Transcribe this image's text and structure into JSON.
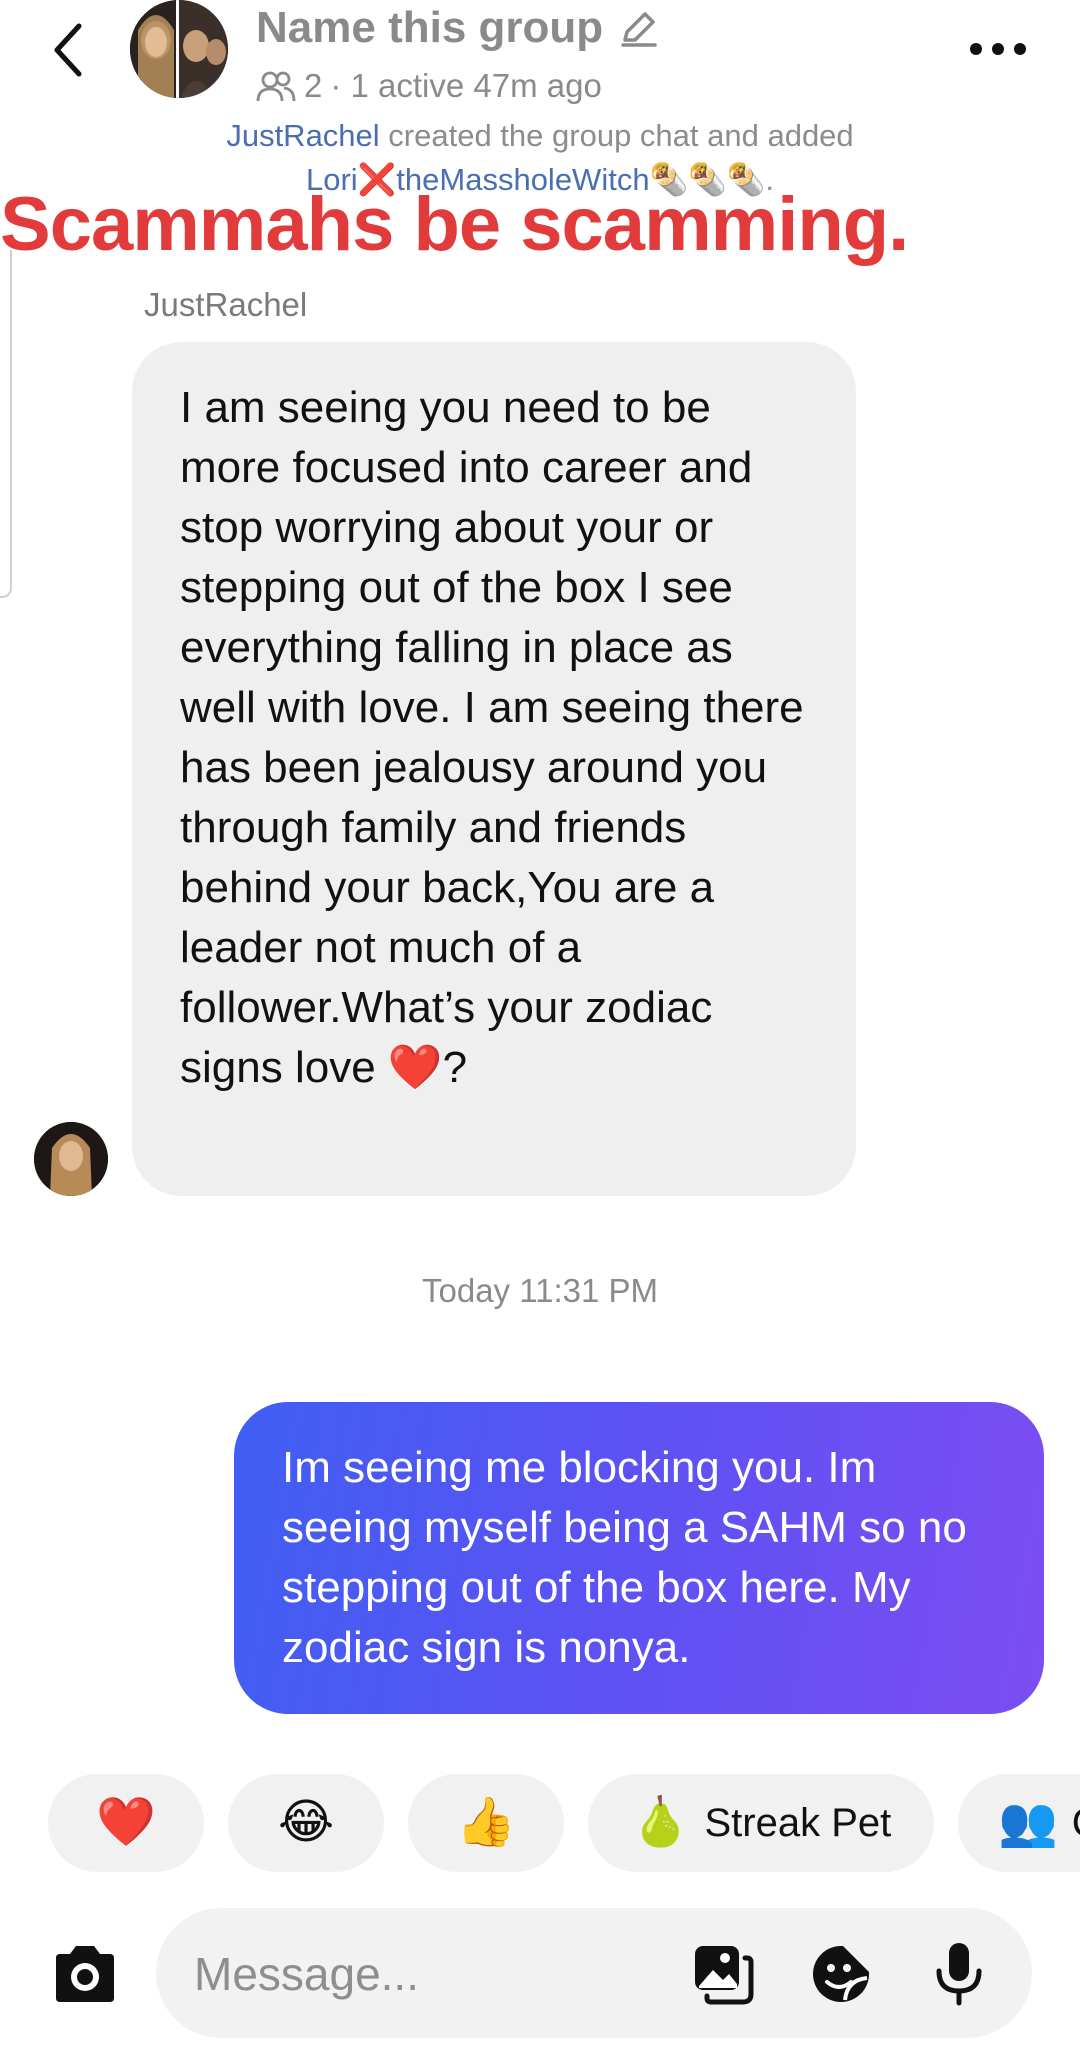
{
  "header": {
    "title": "Name this group",
    "members": "2",
    "status": "· 1 active 47m ago"
  },
  "system_notice": {
    "actor": "JustRachel",
    "middle": " created the group chat and added ",
    "target": "Lori❌theMassholeWitch🌯🌯🌯",
    "end": "."
  },
  "overlay_caption": "Scammahs be scamming.",
  "incoming": {
    "sender": "JustRachel",
    "text": "I am seeing you need to be more focused into career and stop worrying about your or stepping out of the box I see everything falling in place as well with love. I am seeing there has been jealousy around you through family and friends behind your back,You are a leader not much of a follower.What’s your zodiac signs love ❤️?"
  },
  "timestamp": "Today 11:31 PM",
  "outgoing": {
    "text": "Im seeing me blocking you. Im seeing myself being a SAHM so no stepping out of the box here. My zodiac sign is nonya."
  },
  "quick_reactions": [
    {
      "emoji": "❤️",
      "label": ""
    },
    {
      "emoji": "😂",
      "label": ""
    },
    {
      "emoji": "👍",
      "label": ""
    },
    {
      "emoji": "🍐",
      "label": "Streak Pet"
    },
    {
      "emoji": "👥",
      "label": "C"
    }
  ],
  "composer": {
    "placeholder": "Message..."
  },
  "colors": {
    "outgoing_gradient_start": "#3f5ff2",
    "outgoing_gradient_end": "#7c4df2",
    "incoming_bubble": "#efefef",
    "caption_red": "#e23b3b",
    "link_blue": "#4a6fb0"
  }
}
